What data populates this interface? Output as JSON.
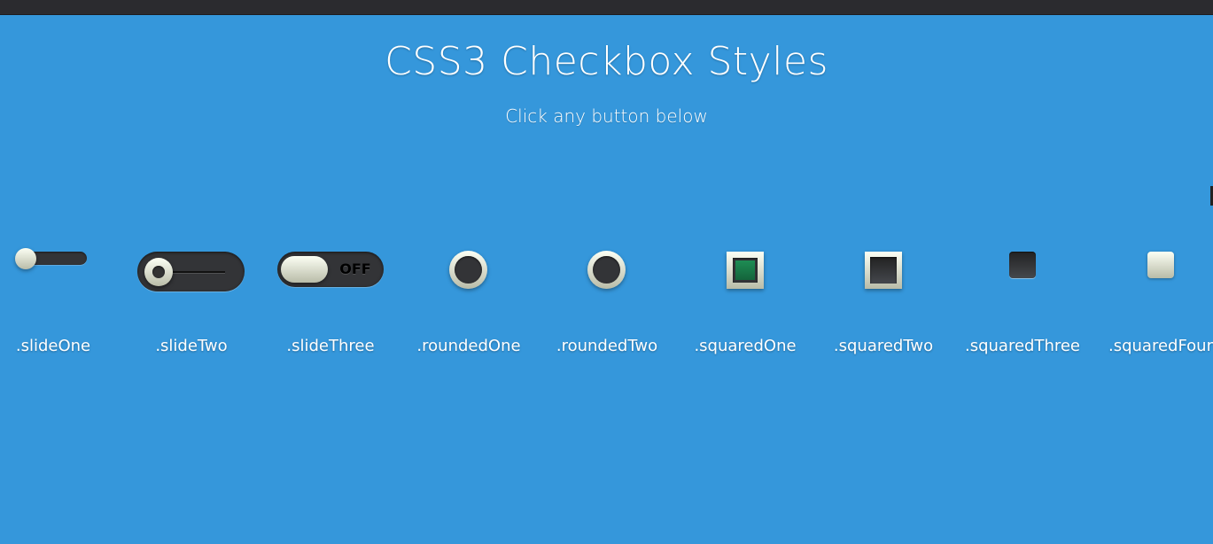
{
  "header": {
    "title": "CSS3 Checkbox Styles",
    "subtitle": "Click any button below"
  },
  "checkboxes": [
    {
      "label": ".slideOne",
      "checked": false
    },
    {
      "label": ".slideTwo",
      "checked": false
    },
    {
      "label": ".slideThree",
      "checked": false,
      "state_text": "OFF"
    },
    {
      "label": ".roundedOne",
      "checked": false
    },
    {
      "label": ".roundedTwo",
      "checked": false
    },
    {
      "label": ".squaredOne",
      "checked": true
    },
    {
      "label": ".squaredTwo",
      "checked": false
    },
    {
      "label": ".squaredThree",
      "checked": false
    },
    {
      "label": ".squaredFour",
      "checked": false
    }
  ],
  "colors": {
    "background": "#3597db",
    "topbar": "#2b2b2f",
    "track": "#333437",
    "knob": "#fcfff4",
    "check_green": "#1e8d54",
    "text": "#ffffff"
  }
}
